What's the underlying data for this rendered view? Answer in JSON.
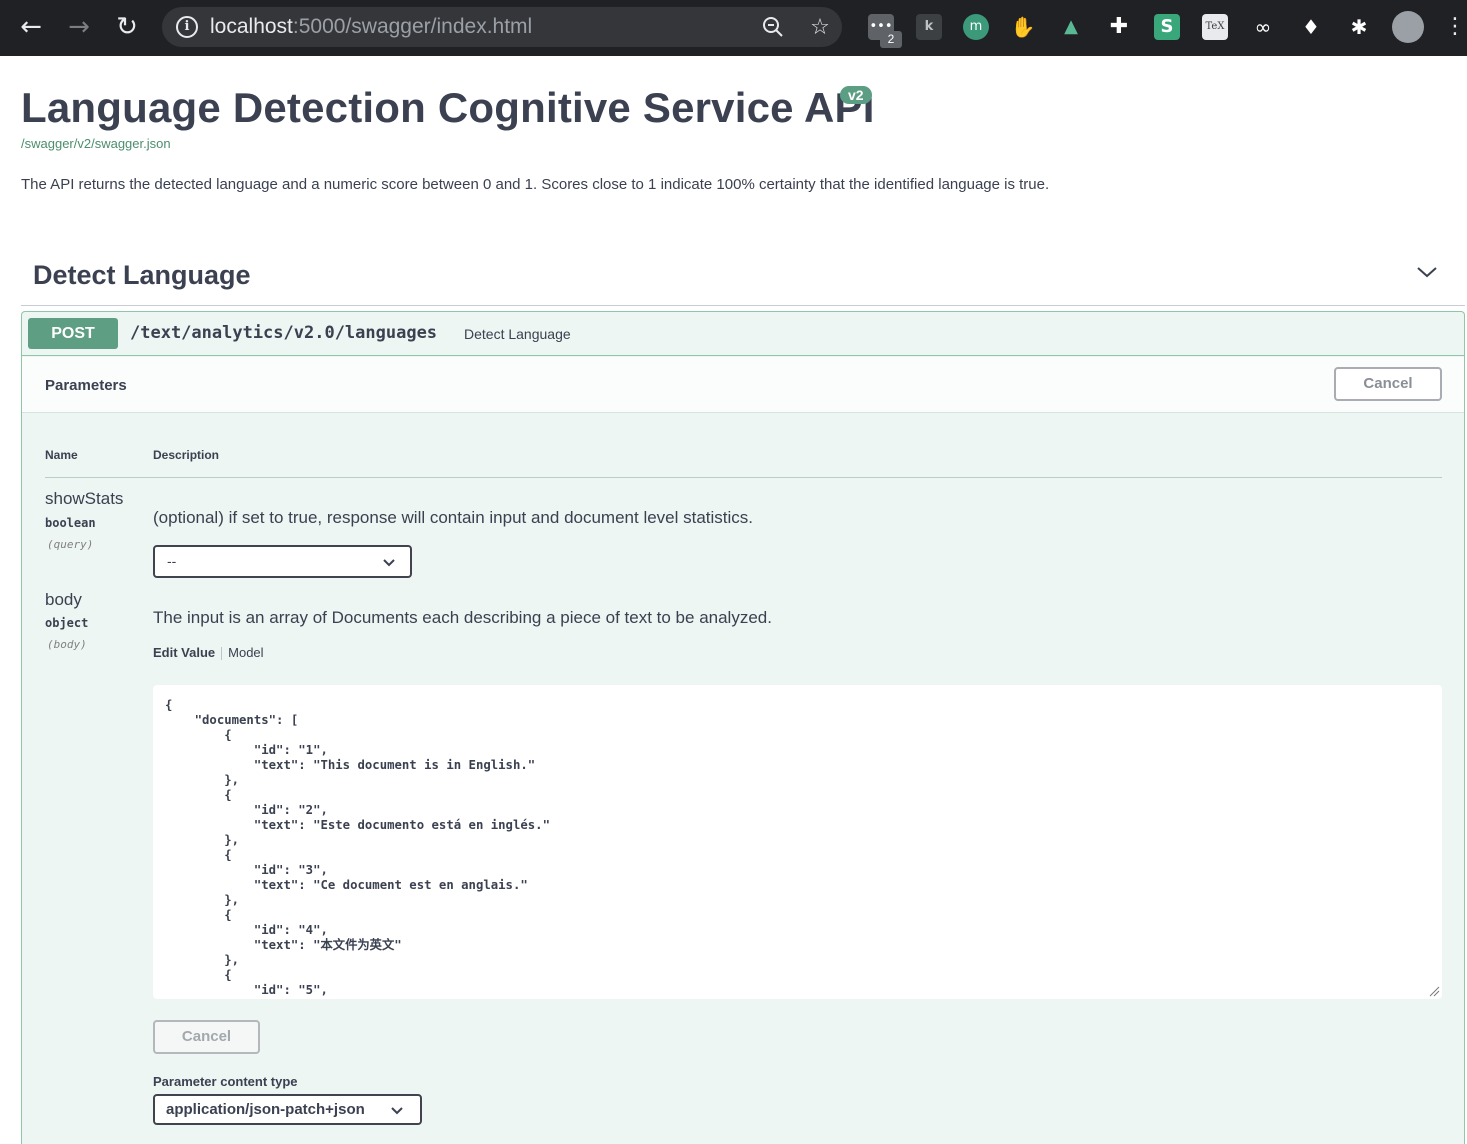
{
  "browser": {
    "url_host": "localhost",
    "url_rest": ":5000/swagger/index.html",
    "extension_badge": "2"
  },
  "api": {
    "title": "Language Detection Cognitive Service API",
    "version": "v2",
    "spec_link": "/swagger/v2/swagger.json",
    "description": "The API returns the detected language and a numeric score between 0 and 1. Scores close to 1 indicate 100% certainty that the identified language is true."
  },
  "tag": {
    "title": "Detect Language"
  },
  "operation": {
    "method": "POST",
    "path": "/text/analytics/v2.0/languages",
    "summary": "Detect Language",
    "parameters_title": "Parameters",
    "cancel_label": "Cancel",
    "columns": {
      "name": "Name",
      "description": "Description"
    },
    "params": [
      {
        "name": "showStats",
        "type": "boolean",
        "in": "(query)",
        "description": "(optional) if set to true, response will contain input and document level statistics.",
        "selected": "--"
      },
      {
        "name": "body",
        "type": "object",
        "in": "(body)",
        "description": "The input is an array of Documents each describing a piece of text to be analyzed.",
        "tab_edit": "Edit Value",
        "tab_model": "Model",
        "value": "{\n    \"documents\": [\n        {\n            \"id\": \"1\",\n            \"text\": \"This document is in English.\"\n        },\n        {\n            \"id\": \"2\",\n            \"text\": \"Este documento está en inglés.\"\n        },\n        {\n            \"id\": \"3\",\n            \"text\": \"Ce document est en anglais.\"\n        },\n        {\n            \"id\": \"4\",\n            \"text\": \"本文件为英文\"\n        },\n        {\n            \"id\": \"5\","
      }
    ],
    "body_cancel_label": "Cancel",
    "content_type_label": "Parameter content type",
    "content_type_value": "application/json-patch+json"
  }
}
